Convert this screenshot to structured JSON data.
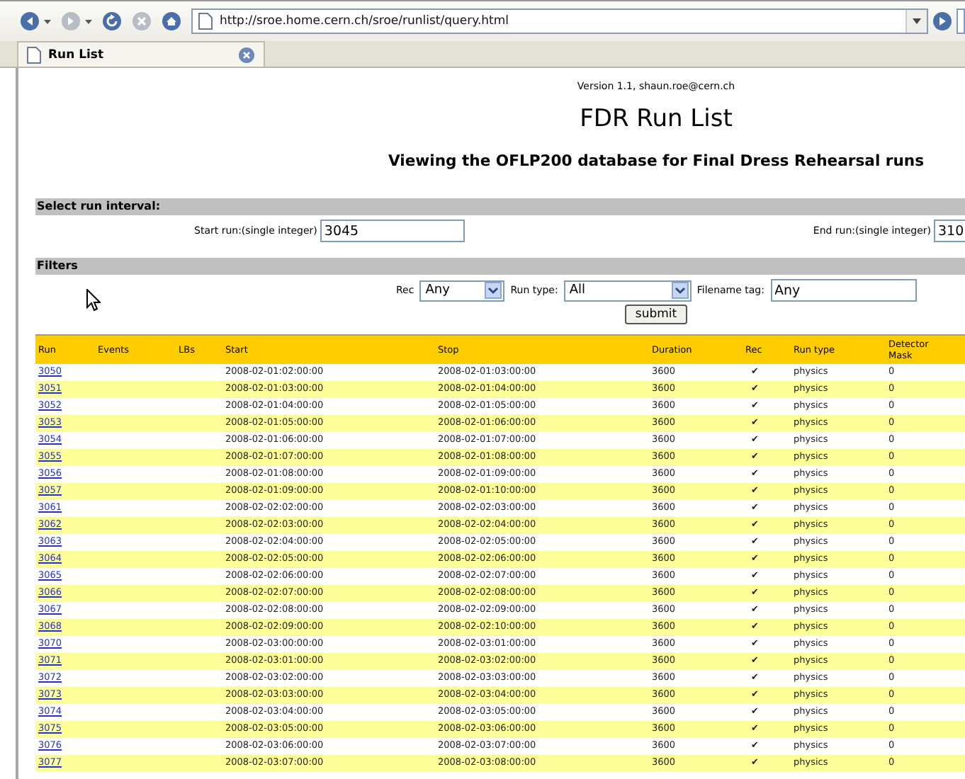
{
  "browser": {
    "nav_buttons": [
      {
        "kind": "back",
        "disabled": false
      },
      {
        "kind": "forward",
        "disabled": true
      },
      {
        "kind": "reload",
        "disabled": false
      },
      {
        "kind": "stop",
        "disabled": true
      },
      {
        "kind": "home",
        "disabled": false
      }
    ],
    "address": "http://sroe.home.cern.ch/sroe/runlist/query.html",
    "tab": {
      "title": "Run List",
      "selected": true
    }
  },
  "page": {
    "version": "Version 1.1, shaun.roe@cern.ch",
    "title": "FDR Run List",
    "subtitle": "Viewing the OFLP200 database for Final Dress Rehearsal runs",
    "interval": {
      "heading": "Select run interval:",
      "start_label": "Start run:(single integer)",
      "start_value": "3045",
      "end_label": "End run:(single integer)",
      "end_value": "310"
    },
    "filters": {
      "heading": "Filters",
      "rec_label": "Rec",
      "rec_value": "Any",
      "type_label": "Run type:",
      "type_value": "All",
      "tag_label": "Filename tag:",
      "tag_value": "Any",
      "submit": "submit"
    },
    "table": {
      "columns": [
        "Run",
        "Events",
        "LBs",
        "Start",
        "Stop",
        "Duration",
        "Rec",
        "Run type",
        "Detector Mask"
      ],
      "rows": [
        {
          "run": "3050",
          "start": "2008-02-01:02:00:00",
          "stop": "2008-02-01:03:00:00",
          "duration": "3600",
          "rec": "✔",
          "run_type": "physics",
          "mask": "0"
        },
        {
          "run": "3051",
          "start": "2008-02-01:03:00:00",
          "stop": "2008-02-01:04:00:00",
          "duration": "3600",
          "rec": "✔",
          "run_type": "physics",
          "mask": "0"
        },
        {
          "run": "3052",
          "start": "2008-02-01:04:00:00",
          "stop": "2008-02-01:05:00:00",
          "duration": "3600",
          "rec": "✔",
          "run_type": "physics",
          "mask": "0"
        },
        {
          "run": "3053",
          "start": "2008-02-01:05:00:00",
          "stop": "2008-02-01:06:00:00",
          "duration": "3600",
          "rec": "✔",
          "run_type": "physics",
          "mask": "0"
        },
        {
          "run": "3054",
          "start": "2008-02-01:06:00:00",
          "stop": "2008-02-01:07:00:00",
          "duration": "3600",
          "rec": "✔",
          "run_type": "physics",
          "mask": "0"
        },
        {
          "run": "3055",
          "start": "2008-02-01:07:00:00",
          "stop": "2008-02-01:08:00:00",
          "duration": "3600",
          "rec": "✔",
          "run_type": "physics",
          "mask": "0"
        },
        {
          "run": "3056",
          "start": "2008-02-01:08:00:00",
          "stop": "2008-02-01:09:00:00",
          "duration": "3600",
          "rec": "✔",
          "run_type": "physics",
          "mask": "0"
        },
        {
          "run": "3057",
          "start": "2008-02-01:09:00:00",
          "stop": "2008-02-01:10:00:00",
          "duration": "3600",
          "rec": "✔",
          "run_type": "physics",
          "mask": "0"
        },
        {
          "run": "3061",
          "start": "2008-02-02:02:00:00",
          "stop": "2008-02-02:03:00:00",
          "duration": "3600",
          "rec": "✔",
          "run_type": "physics",
          "mask": "0"
        },
        {
          "run": "3062",
          "start": "2008-02-02:03:00:00",
          "stop": "2008-02-02:04:00:00",
          "duration": "3600",
          "rec": "✔",
          "run_type": "physics",
          "mask": "0"
        },
        {
          "run": "3063",
          "start": "2008-02-02:04:00:00",
          "stop": "2008-02-02:05:00:00",
          "duration": "3600",
          "rec": "✔",
          "run_type": "physics",
          "mask": "0"
        },
        {
          "run": "3064",
          "start": "2008-02-02:05:00:00",
          "stop": "2008-02-02:06:00:00",
          "duration": "3600",
          "rec": "✔",
          "run_type": "physics",
          "mask": "0"
        },
        {
          "run": "3065",
          "start": "2008-02-02:06:00:00",
          "stop": "2008-02-02:07:00:00",
          "duration": "3600",
          "rec": "✔",
          "run_type": "physics",
          "mask": "0"
        },
        {
          "run": "3066",
          "start": "2008-02-02:07:00:00",
          "stop": "2008-02-02:08:00:00",
          "duration": "3600",
          "rec": "✔",
          "run_type": "physics",
          "mask": "0"
        },
        {
          "run": "3067",
          "start": "2008-02-02:08:00:00",
          "stop": "2008-02-02:09:00:00",
          "duration": "3600",
          "rec": "✔",
          "run_type": "physics",
          "mask": "0"
        },
        {
          "run": "3068",
          "start": "2008-02-02:09:00:00",
          "stop": "2008-02-02:10:00:00",
          "duration": "3600",
          "rec": "✔",
          "run_type": "physics",
          "mask": "0"
        },
        {
          "run": "3070",
          "start": "2008-02-03:00:00:00",
          "stop": "2008-02-03:01:00:00",
          "duration": "3600",
          "rec": "✔",
          "run_type": "physics",
          "mask": "0"
        },
        {
          "run": "3071",
          "start": "2008-02-03:01:00:00",
          "stop": "2008-02-03:02:00:00",
          "duration": "3600",
          "rec": "✔",
          "run_type": "physics",
          "mask": "0"
        },
        {
          "run": "3072",
          "start": "2008-02-03:02:00:00",
          "stop": "2008-02-03:03:00:00",
          "duration": "3600",
          "rec": "✔",
          "run_type": "physics",
          "mask": "0"
        },
        {
          "run": "3073",
          "start": "2008-02-03:03:00:00",
          "stop": "2008-02-03:04:00:00",
          "duration": "3600",
          "rec": "✔",
          "run_type": "physics",
          "mask": "0"
        },
        {
          "run": "3074",
          "start": "2008-02-03:04:00:00",
          "stop": "2008-02-03:05:00:00",
          "duration": "3600",
          "rec": "✔",
          "run_type": "physics",
          "mask": "0"
        },
        {
          "run": "3075",
          "start": "2008-02-03:05:00:00",
          "stop": "2008-02-03:06:00:00",
          "duration": "3600",
          "rec": "✔",
          "run_type": "physics",
          "mask": "0"
        },
        {
          "run": "3076",
          "start": "2008-02-03:06:00:00",
          "stop": "2008-02-03:07:00:00",
          "duration": "3600",
          "rec": "✔",
          "run_type": "physics",
          "mask": "0"
        },
        {
          "run": "3077",
          "start": "2008-02-03:07:00:00",
          "stop": "2008-02-03:08:00:00",
          "duration": "3600",
          "rec": "✔",
          "run_type": "physics",
          "mask": "0"
        }
      ]
    }
  }
}
